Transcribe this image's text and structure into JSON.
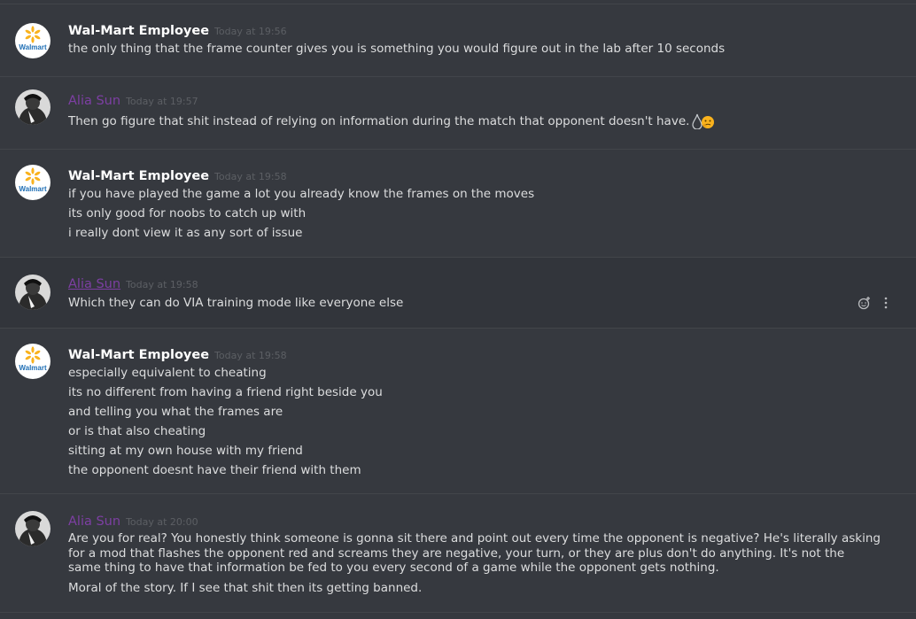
{
  "colors": {
    "background": "#36393f",
    "divider": "#42454a",
    "walmart_name": "#ffffff",
    "alia_name": "#7d3fa3",
    "timestamp": "#5c5f64",
    "text": "#dcddde"
  },
  "messages": [
    {
      "author": "Wal-Mart Employee",
      "timestamp": "Today at 19:56",
      "avatar_text": "Walmart",
      "lines": [
        "the only thing that the frame counter gives you is something you would figure out in the lab after 10 seconds"
      ]
    },
    {
      "author": "Alia Sun",
      "timestamp": "Today at 19:57",
      "lines": [
        "Then go figure that shit instead of relying on information during the match that opponent doesn't have."
      ],
      "emojis": [
        "droplet-emoji",
        "thinking-emoji"
      ]
    },
    {
      "author": "Wal-Mart Employee",
      "timestamp": "Today at 19:58",
      "avatar_text": "Walmart",
      "lines": [
        "if you have played the game a lot you already know the frames on the moves",
        "its only good for noobs to catch up with",
        "i really dont view it as any sort of issue"
      ]
    },
    {
      "author": "Alia Sun",
      "timestamp": "Today at 19:58",
      "lines": [
        "Which they can do VIA training mode like everyone else"
      ],
      "actions": [
        "add-reaction-icon",
        "more-options-icon"
      ]
    },
    {
      "author": "Wal-Mart Employee",
      "timestamp": "Today at 19:58",
      "avatar_text": "Walmart",
      "lines": [
        "especially equivalent to cheating",
        "its no different from having a friend right beside you",
        "and telling you what the frames are",
        "or is that also cheating",
        "sitting at my own house with my friend",
        "the opponent doesnt have their friend with them"
      ]
    },
    {
      "author": "Alia Sun",
      "timestamp": "Today at 20:00",
      "lines": [
        "Are you for real? You honestly think someone is gonna sit there and point out every time the opponent is negative? He's literally asking for a mod that flashes the opponent red and screams they are negative, your turn, or they are plus don't do anything. It's not the same thing to have that information be fed to you every second of a game while the opponent gets nothing.",
        "Moral of the story. If I see that shit then its getting banned."
      ]
    }
  ]
}
